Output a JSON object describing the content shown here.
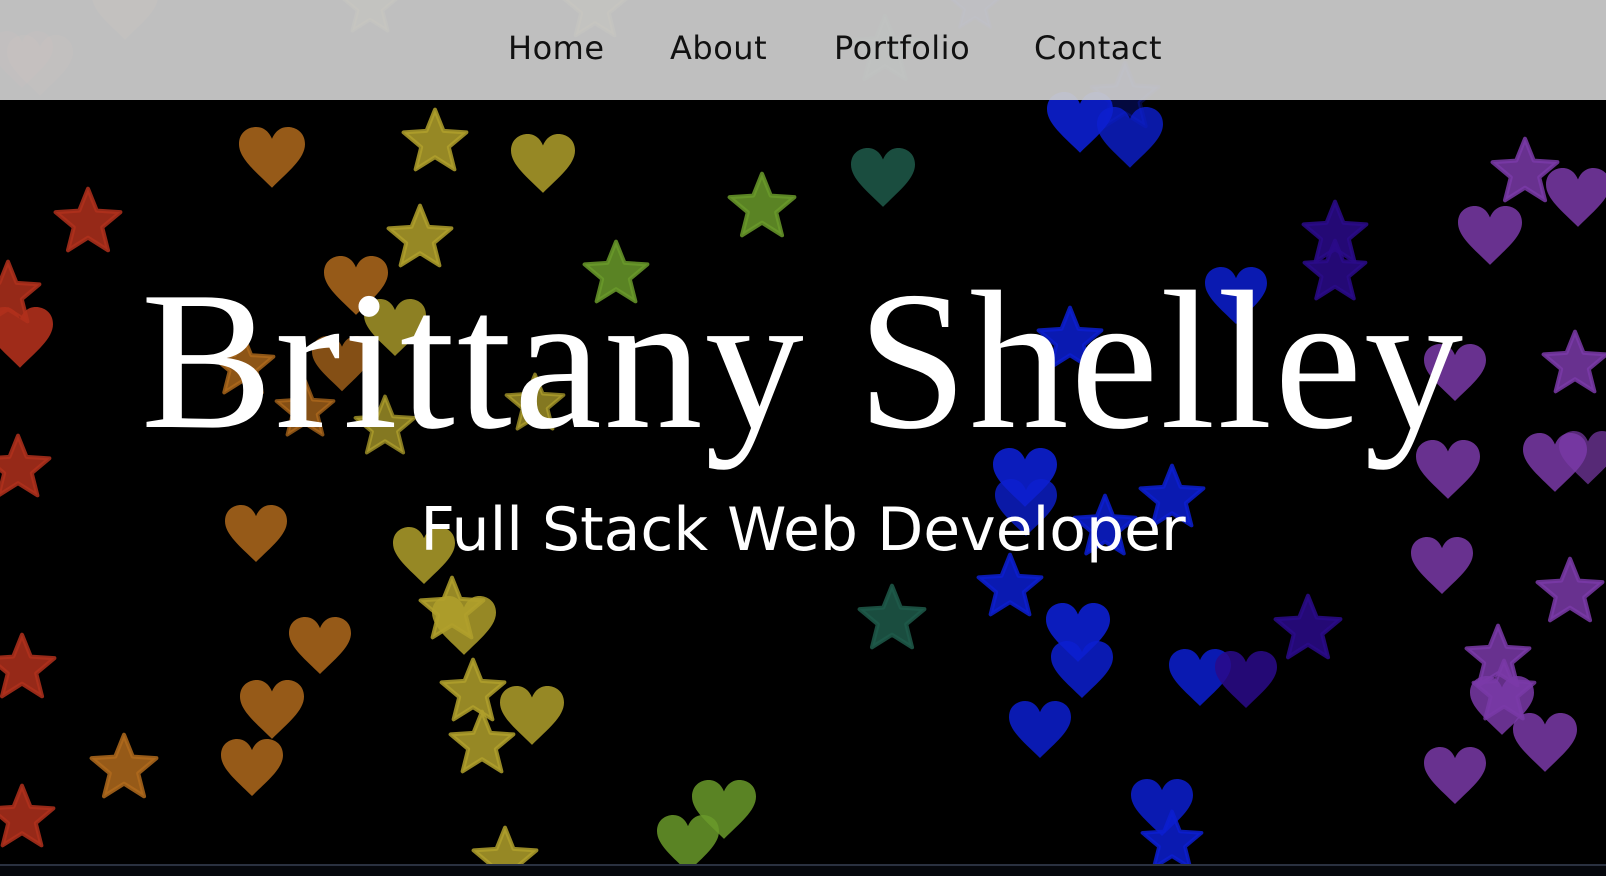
{
  "nav": {
    "items": [
      {
        "label": "Home"
      },
      {
        "label": "About"
      },
      {
        "label": "Portfolio"
      },
      {
        "label": "Contact"
      }
    ]
  },
  "hero": {
    "name": "Brittany Shelley",
    "subtitle": "Full Stack Web Developer"
  },
  "background": {
    "color": "#000000",
    "particle_shapes": [
      "heart-icon",
      "star-icon"
    ],
    "particle_colors": [
      "#b0301c",
      "#b06a1c",
      "#b0a02c",
      "#6a9a2a",
      "#1f5a4a",
      "#0c1fd0",
      "#2a0a8a",
      "#7a3aa8"
    ]
  }
}
